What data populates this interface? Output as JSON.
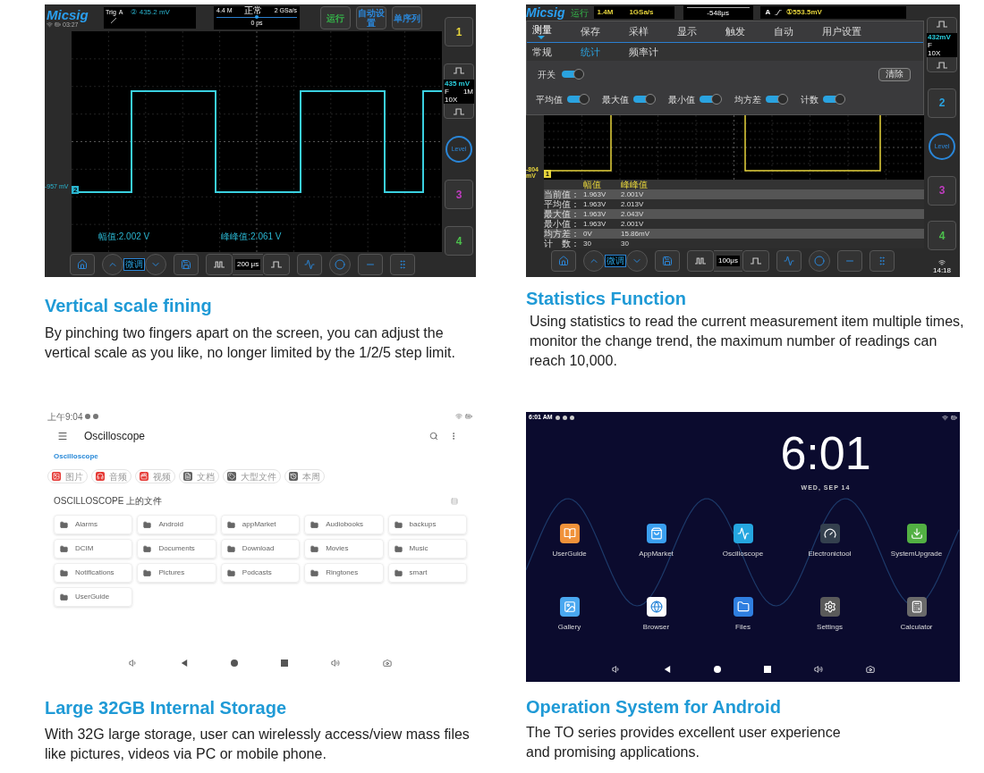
{
  "features": [
    {
      "kind": "scope",
      "heading": "Vertical scale fining",
      "description": "By pinching two fingers apart on the screen, you can adjust the vertical scale as you like, no longer limited by the 1/2/5 step limit.",
      "screen": {
        "logo": "Micsig",
        "clock": "03:27",
        "trigger": {
          "label": "Trig",
          "source": "A",
          "value": "② 435.2 mV"
        },
        "timebase": {
          "memory": "4.4 M",
          "mode": "正常",
          "rate": "2 GSa/s",
          "delay": "0 ps",
          "level": 0.5
        },
        "buttons": [
          {
            "label": "运行",
            "color": "#35b84a"
          },
          {
            "label": "自动设置",
            "color": "#2a86d8"
          },
          {
            "label": "单序列",
            "color": "#2a86d8"
          }
        ],
        "side": [
          {
            "kind": "channel",
            "label": "1",
            "color": "#e6d43c"
          },
          {
            "kind": "scale",
            "scale": "435 mV",
            "coupling": "F",
            "impedance": "1M",
            "probe": "10X"
          },
          {
            "kind": "level",
            "label": "Level"
          },
          {
            "kind": "channel",
            "label": "3",
            "color": "#c03cc0"
          },
          {
            "kind": "channel",
            "label": "4",
            "color": "#4cc04c"
          }
        ],
        "offset": "-957 mV",
        "marker": "2",
        "measurements": [
          "幅值:2.002 V",
          "峰峰值:2.061 V"
        ],
        "fine_button": "微调",
        "timebase_scale": "200 μs"
      }
    },
    {
      "kind": "stats",
      "heading": "Statistics Function",
      "description": "Using statistics to read the current measurement item multiple times, monitor the change trend, the maximum number of readings can reach 10,000.",
      "screen": {
        "logo": "Micsig",
        "status": "运行",
        "memory": "1.4M",
        "rate": "1GSa/s",
        "delay": "-548μs",
        "trigger_source": "A",
        "trigger_level": "①553.5mV",
        "menu_tabs": [
          {
            "label": "测量",
            "selected": true
          },
          {
            "label": "保存",
            "selected": false
          },
          {
            "label": "采样",
            "selected": false
          },
          {
            "label": "显示",
            "selected": false
          },
          {
            "label": "触发",
            "selected": false
          },
          {
            "label": "自动",
            "selected": false
          },
          {
            "label": "用户设置",
            "selected": false
          }
        ],
        "sub_tabs": [
          {
            "label": "常规",
            "selected": false
          },
          {
            "label": "统计",
            "selected": true
          },
          {
            "label": "频率计",
            "selected": false
          }
        ],
        "master_toggle": {
          "label": "开关",
          "on": true
        },
        "clear_button": "清除",
        "stat_toggles": [
          {
            "label": "平均值",
            "on": true
          },
          {
            "label": "最大值",
            "on": true
          },
          {
            "label": "最小值",
            "on": true
          },
          {
            "label": "均方差",
            "on": true
          },
          {
            "label": "计数",
            "on": true
          }
        ],
        "side": [
          {
            "kind": "scale",
            "scale": "432mV",
            "coupling": "F",
            "probe": "10X"
          },
          {
            "kind": "channel",
            "label": "2",
            "color": "#2aa3e0"
          },
          {
            "kind": "level",
            "label": "Level"
          },
          {
            "kind": "channel",
            "label": "3",
            "color": "#c03cc0"
          },
          {
            "kind": "channel",
            "label": "4",
            "color": "#4cc04c"
          }
        ],
        "offset": "-804 mV",
        "marker": "1",
        "table": {
          "columns": [
            "幅值",
            "峰峰值"
          ],
          "rows": [
            {
              "label": "当前值：",
              "amplitude": "1.963V",
              "peak_to_peak": "2.001V"
            },
            {
              "label": "平均值：",
              "amplitude": "1.963V",
              "peak_to_peak": "2.013V"
            },
            {
              "label": "最大值：",
              "amplitude": "1.963V",
              "peak_to_peak": "2.043V"
            },
            {
              "label": "最小值：",
              "amplitude": "1.963V",
              "peak_to_peak": "2.001V"
            },
            {
              "label": "均方差：",
              "amplitude": "0V",
              "peak_to_peak": "15.86mV"
            },
            {
              "label": "计　数：",
              "amplitude": "30",
              "peak_to_peak": "30"
            }
          ]
        },
        "fine_button": "微调",
        "timebase_scale": "100μs",
        "clock": "14:18"
      }
    },
    {
      "kind": "files",
      "heading": "Large 32GB Internal Storage",
      "description": "With 32G large storage, user can wirelessly access/view mass files like pictures, videos via PC or mobile phone.",
      "screen": {
        "clock": "上午9:04",
        "title": "Oscilloscope",
        "breadcrumb": "Oscilloscope",
        "chips": [
          {
            "label": "图片",
            "color": "#e53935"
          },
          {
            "label": "音频",
            "color": "#e53935"
          },
          {
            "label": "视频",
            "color": "#e53935"
          },
          {
            "label": "文档",
            "color": "#5f5f5f"
          },
          {
            "label": "大型文件",
            "color": "#5f5f5f"
          },
          {
            "label": "本周",
            "color": "#5f5f5f"
          }
        ],
        "section": "OSCILLOSCOPE 上的文件",
        "folders": [
          "Alarms",
          "Android",
          "appMarket",
          "Audiobooks",
          "backups",
          "DCIM",
          "Documents",
          "Download",
          "Movies",
          "Music",
          "Notifications",
          "Pictures",
          "Podcasts",
          "Ringtones",
          "smart",
          "UserGuide"
        ]
      }
    },
    {
      "kind": "home",
      "heading": "Operation System for Android",
      "description": "The TO series provides excellent user experience and promising applications.",
      "screen": {
        "status_clock": "6:01 AM",
        "clock": "6:01",
        "date": "WED, SEP 14",
        "apps": [
          {
            "label": "UserGuide",
            "color": "#f0923a"
          },
          {
            "label": "AppMarket",
            "color": "#3a9ff0"
          },
          {
            "label": "Oscilloscope",
            "color": "#25a6e0"
          },
          {
            "label": "Electronictool",
            "color": "#34404e"
          },
          {
            "label": "SystemUpgrade",
            "color": "#52b043"
          },
          {
            "label": "Gallery",
            "color": "#4aa8f0"
          },
          {
            "label": "Browser",
            "color": "#ffffff"
          },
          {
            "label": "Files",
            "color": "#2f7fe0"
          },
          {
            "label": "Settings",
            "color": "#5a5a5a"
          },
          {
            "label": "Calculator",
            "color": "#6a6a6a"
          }
        ]
      }
    }
  ]
}
